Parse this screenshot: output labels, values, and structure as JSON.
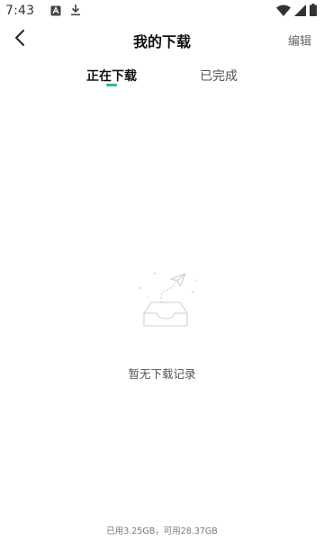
{
  "status_bar": {
    "time": "7:43",
    "icons": [
      "a-box-icon",
      "download-icon",
      "wifi-icon",
      "signal-icon",
      "battery-icon"
    ]
  },
  "header": {
    "title": "我的下载",
    "edit_label": "编辑"
  },
  "tabs": [
    {
      "label": "正在下载",
      "active": true
    },
    {
      "label": "已完成",
      "active": false
    }
  ],
  "empty_state": {
    "message": "暂无下载记录"
  },
  "storage": {
    "text": "已用3.25GB，可用28.37GB"
  },
  "colors": {
    "accent": "#2bbf72"
  }
}
